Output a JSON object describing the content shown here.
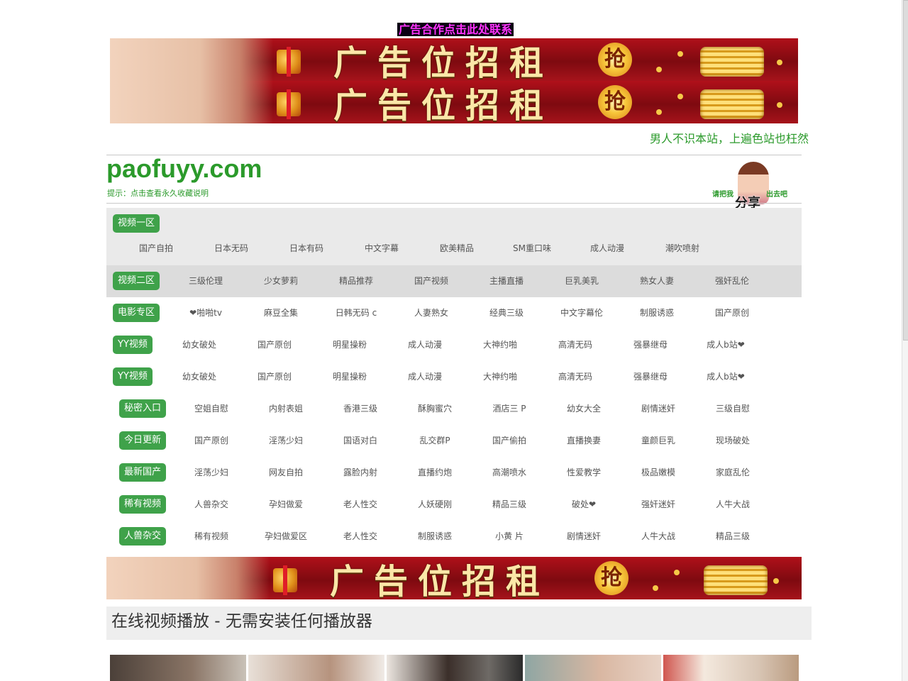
{
  "ad_contact": "广告合作点击此处联系",
  "banner": {
    "text": "广告位招租",
    "grab": "抢"
  },
  "slogan": "男人不识本站，上遍色站也枉然",
  "logo": "paofuyy.com",
  "tip": "提示：点击查看永久收藏说明",
  "share": {
    "left": "请把我",
    "right": "出去吧",
    "big": "分享"
  },
  "nav": [
    {
      "label": "视频一区",
      "links": [
        "国产自拍",
        "日本无码",
        "日本有码",
        "中文字幕",
        "欧美精品",
        "SM重口味",
        "成人动漫",
        "潮吹喷射"
      ]
    },
    {
      "label": "视频二区",
      "links": [
        "三级伦理",
        "少女萝莉",
        "精品推荐",
        "国产视频",
        "主播直播",
        "巨乳美乳",
        "熟女人妻",
        "强奸乱伦"
      ]
    },
    {
      "label": "电影专区",
      "links": [
        "❤啪啪tv",
        "麻豆全集",
        "日韩无码 c",
        "人妻熟女",
        "经典三级",
        "中文字幕伦",
        "制服诱惑",
        "国产原创"
      ]
    },
    {
      "label": "YY视频",
      "links": [
        "幼女破处",
        "国产原创",
        "明星操粉",
        "成人动漫",
        "大神约啪",
        "高清无码",
        "强暴继母",
        "成人b站❤"
      ]
    },
    {
      "label": "YY视频",
      "links": [
        "幼女破处",
        "国产原创",
        "明星操粉",
        "成人动漫",
        "大神约啪",
        "高清无码",
        "强暴继母",
        "成人b站❤"
      ]
    },
    {
      "label": "秘密入口",
      "links": [
        "空姐自慰",
        "内射表姐",
        "香港三级",
        "酥胸蜜穴",
        "酒店三 P",
        "幼女大全",
        "剧情迷奸",
        "三级自慰"
      ]
    },
    {
      "label": "今日更新",
      "links": [
        "国产原创",
        "淫荡少妇",
        "国语对白",
        "乱交群P",
        "国产偷拍",
        "直播换妻",
        "童颜巨乳",
        "现场破处"
      ]
    },
    {
      "label": "最新国产",
      "links": [
        "淫荡少妇",
        "网友自拍",
        "露脸内射",
        "直播约炮",
        "高潮喷水",
        "性爱教学",
        "极品嫩模",
        "家庭乱伦"
      ]
    },
    {
      "label": "稀有视频",
      "links": [
        "人兽杂交",
        "孕妇做爱",
        "老人性交",
        "人妖硬刚",
        "精品三级",
        "破处❤",
        "强奸迷奸",
        "人牛大战"
      ]
    },
    {
      "label": "人兽杂交",
      "links": [
        "稀有视频",
        "孕妇做爱区",
        "老人性交",
        "制服诱惑",
        "小黄 片",
        "剧情迷奸",
        "人牛大战",
        "精品三级"
      ]
    }
  ],
  "section_title": "在线视频播放 - 无需安装任何播放器",
  "colors": {
    "green": "#3fa24a",
    "text_green": "#2b9a2b",
    "ad_text": "#ff33ff"
  },
  "thumbnail_count": 5
}
